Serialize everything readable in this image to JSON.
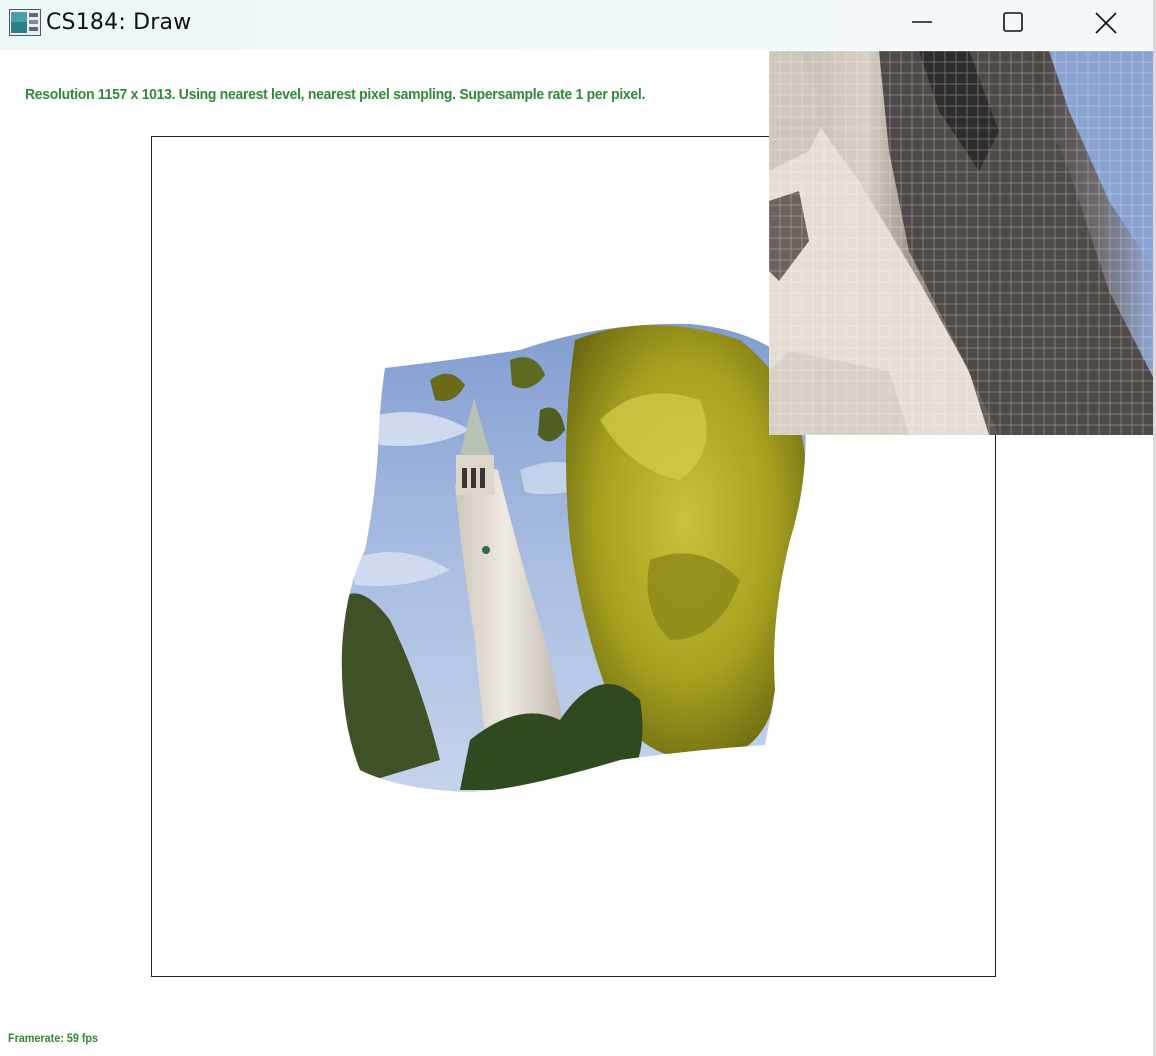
{
  "window": {
    "title": "CS184: Draw",
    "icon": "app-window-icon",
    "controls": [
      "minimize-icon",
      "maximize-icon",
      "close-icon"
    ]
  },
  "status": {
    "text": "Resolution 1157 x 1013. Using nearest level, nearest pixel sampling. Supersample rate 1 per pixel."
  },
  "footer": {
    "framerate": "Framerate: 59 fps"
  },
  "colors": {
    "status_green": "#2e8b37",
    "frame_border": "#222222",
    "sky": "#8fa9d9",
    "tower": "#e4ded4",
    "foliage": "#a5a51c"
  }
}
